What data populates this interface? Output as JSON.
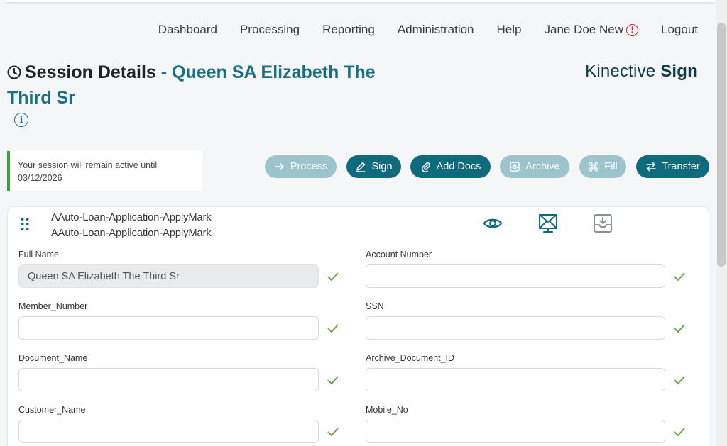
{
  "nav": {
    "items": [
      "Dashboard",
      "Processing",
      "Reporting",
      "Administration",
      "Help"
    ],
    "user": "Jane Doe New",
    "logout": "Logout"
  },
  "page": {
    "title_label": "Session Details",
    "title_sep": " - ",
    "title_name": "Queen SA Elizabeth The Third Sr",
    "brand_prefix": "Kinective ",
    "brand_bold": "Sign"
  },
  "session": {
    "line1": "Your session will remain active until",
    "line2": "03/12/2026"
  },
  "actions": {
    "process": "Process",
    "sign": "Sign",
    "add_docs": "Add Docs",
    "archive": "Archive",
    "fill": "Fill",
    "transfer": "Transfer"
  },
  "document": {
    "name_line1": "AAuto-Loan-Application-ApplyMark",
    "name_line2": "AAuto-Loan-Application-ApplyMark"
  },
  "fields": {
    "full_name": {
      "label": "Full Name",
      "value": "Queen SA Elizabeth The Third Sr"
    },
    "account_number": {
      "label": "Account Number",
      "value": ""
    },
    "member_number": {
      "label": "Member_Number",
      "value": ""
    },
    "ssn": {
      "label": "SSN",
      "value": ""
    },
    "document_name": {
      "label": "Document_Name",
      "value": ""
    },
    "archive_document_id": {
      "label": "Archive_Document_ID",
      "value": ""
    },
    "customer_name": {
      "label": "Customer_Name",
      "value": ""
    },
    "mobile_no": {
      "label": "Mobile_No",
      "value": ""
    }
  },
  "colors": {
    "accent": "#1a6f82",
    "button_dark": "#0f6a7c",
    "button_light": "#9cc4cd",
    "success": "#6aa84f",
    "alert": "#d42020"
  }
}
